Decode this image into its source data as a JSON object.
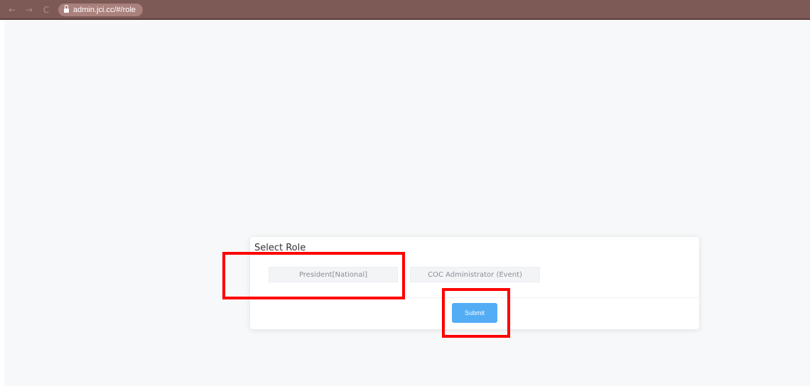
{
  "browser": {
    "url": "admin.jci.cc/#/role",
    "back_glyph": "←",
    "forward_glyph": "→",
    "reload_glyph": "C"
  },
  "card": {
    "title": "Select Role",
    "roles": [
      {
        "label": "President[National]"
      },
      {
        "label": "COC Administrator (Event)"
      }
    ],
    "submit_label": "Submit"
  },
  "colors": {
    "browser_bar": "#7d5a56",
    "page_background": "#f7f8f9",
    "submit_button": "#53adf5",
    "annotation_box": "#ff0000"
  }
}
